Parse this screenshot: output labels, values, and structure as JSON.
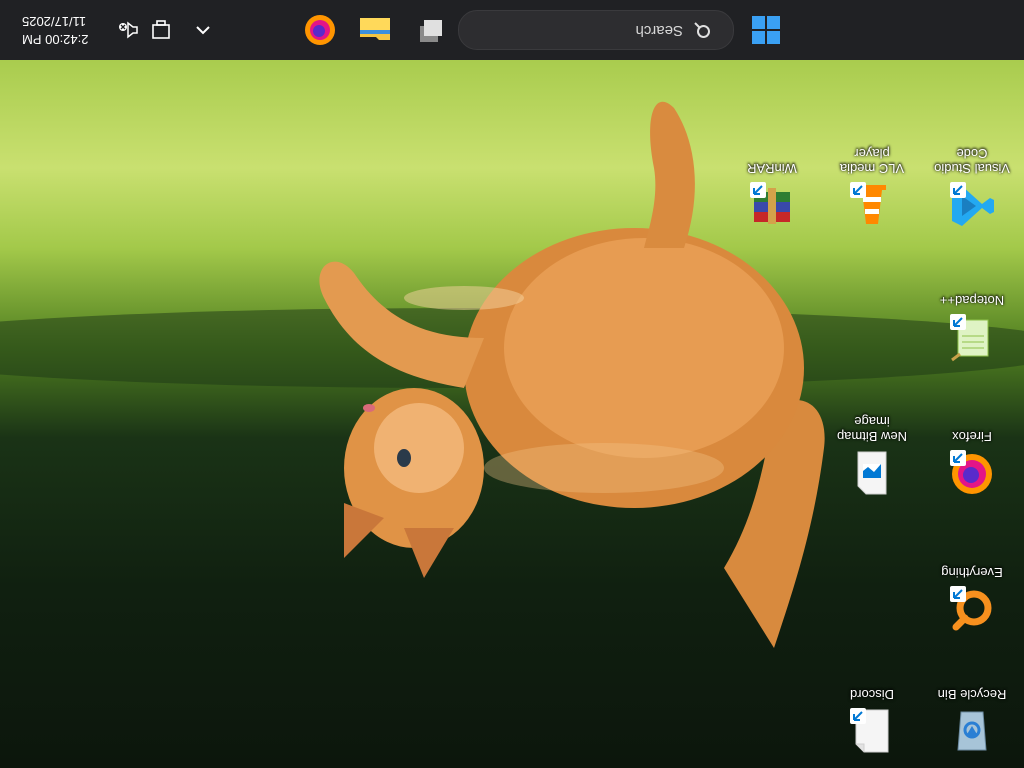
{
  "desktop": {
    "icons": [
      {
        "label": "Recycle Bin",
        "icon": "recycle-bin-icon"
      },
      {
        "label": "Discord",
        "icon": "file-icon"
      },
      {
        "label": "Everything",
        "icon": "everything-icon"
      },
      {
        "label": "Firefox",
        "icon": "firefox-icon"
      },
      {
        "label": "New Bitmap image",
        "icon": "bitmap-image-icon"
      },
      {
        "label": "Notepad++",
        "icon": "notepad-plus-plus-icon"
      },
      {
        "label": "Visual Studio Code",
        "icon": "vscode-icon"
      },
      {
        "label": "VLC media player",
        "icon": "vlc-icon"
      },
      {
        "label": "WinRAR",
        "icon": "winrar-icon"
      }
    ]
  },
  "taskbar": {
    "search_placeholder": "Search",
    "time": "2:42:00 PM",
    "date": "11/17/2025",
    "pinned": [
      "windows-start-icon",
      "task-view-icon",
      "file-explorer-icon",
      "firefox-icon"
    ],
    "tray": [
      "chevron-up-icon",
      "network-icon",
      "volume-muted-icon"
    ]
  },
  "colors": {
    "taskbar": "#202124",
    "accent": "#0078d4"
  }
}
